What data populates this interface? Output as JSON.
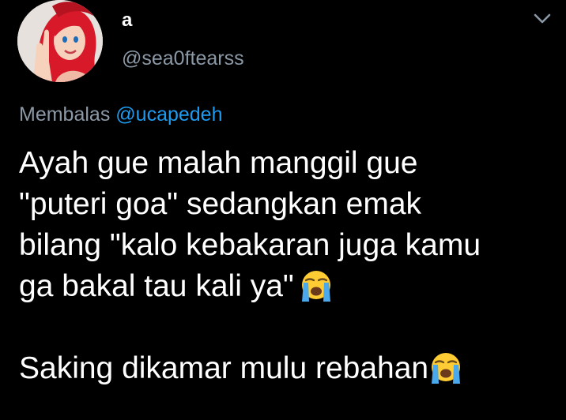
{
  "tweet": {
    "display_name": "a",
    "username": "@sea0ftearss",
    "reply_prefix": "Membalas",
    "reply_to": "@ucapedeh",
    "lines": [
      "Ayah gue malah manggil gue",
      "\"puteri goa\" sedangkan emak",
      "bilang \"kalo kebakaran juga kamu",
      "ga bakal tau kali ya\"",
      "Saking dikamar mulu rebahan"
    ],
    "emoji": "loudly-crying-face"
  },
  "colors": {
    "background": "#000000",
    "text": "#ffffff",
    "secondary": "#8b98a5",
    "link": "#1d9bf0"
  },
  "icons": {
    "menu": "chevron-down-icon",
    "emoji": "loudly-crying-face-icon"
  }
}
